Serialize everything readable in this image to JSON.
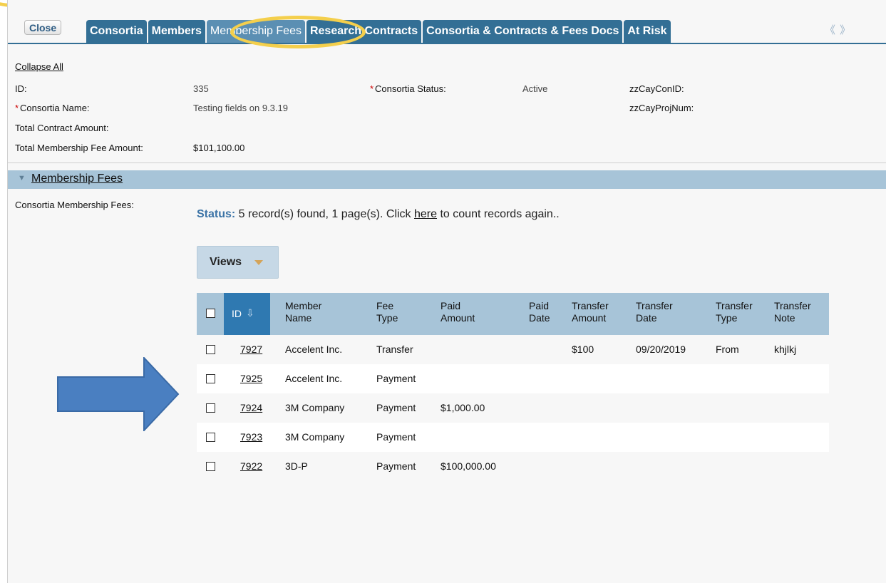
{
  "toolbar": {
    "close_label": "Close"
  },
  "tabs": [
    {
      "label": "Consortia"
    },
    {
      "label": "Members"
    },
    {
      "label": "Membership Fees"
    },
    {
      "label": "Research Contracts"
    },
    {
      "label": "Consortia & Contracts & Fees Docs"
    },
    {
      "label": "At Risk"
    }
  ],
  "tab_scroll": "《 》",
  "record": {
    "collapse_all": "Collapse All",
    "id_label": "ID:",
    "id_value": "335",
    "name_label": "Consortia Name:",
    "name_value": "Testing fields on 9.3.19",
    "total_contract_label": "Total Contract Amount:",
    "total_fee_label": "Total Membership Fee Amount:",
    "total_fee_value": "$101,100.00",
    "status_label": "Consortia Status:",
    "status_value": "Active",
    "cay_con_label": "zzCayConID:",
    "cay_proj_label": "zzCayProjNum:",
    "required_mark": "*"
  },
  "section": {
    "title": "Membership Fees",
    "chevron": "▼",
    "field_label": "Consortia Membership Fees:"
  },
  "status": {
    "prefix": "Status:",
    "text_a": " 5 record(s) found, 1 page(s). Click ",
    "link": "here",
    "text_b": " to count records again.."
  },
  "views": {
    "label": "Views"
  },
  "table": {
    "headers": {
      "id": "ID",
      "sort_icon": "⇩",
      "member_name": [
        "Member",
        "Name"
      ],
      "fee_type": [
        "Fee",
        "Type"
      ],
      "paid_amount": [
        "Paid",
        "Amount"
      ],
      "paid_date": [
        "Paid",
        "Date"
      ],
      "transfer_amount": [
        "Transfer",
        "Amount"
      ],
      "transfer_date": [
        "Transfer",
        "Date"
      ],
      "transfer_type": [
        "Transfer",
        "Type"
      ],
      "transfer_note": [
        "Transfer",
        "Note"
      ]
    },
    "rows": [
      {
        "id": "7927",
        "member": "Accelent Inc.",
        "fee_type": "Transfer",
        "paid_amount": "",
        "paid_date": "",
        "transfer_amount": "$100",
        "transfer_date": "09/20/2019",
        "transfer_type": "From",
        "transfer_note": "khjlkj"
      },
      {
        "id": "7925",
        "member": "Accelent Inc.",
        "fee_type": "Payment",
        "paid_amount": "",
        "paid_date": "",
        "transfer_amount": "",
        "transfer_date": "",
        "transfer_type": "",
        "transfer_note": ""
      },
      {
        "id": "7924",
        "member": "3M Company",
        "fee_type": "Payment",
        "paid_amount": "$1,000.00",
        "paid_date": "",
        "transfer_amount": "",
        "transfer_date": "",
        "transfer_type": "",
        "transfer_note": ""
      },
      {
        "id": "7923",
        "member": "3M Company",
        "fee_type": "Payment",
        "paid_amount": "",
        "paid_date": "",
        "transfer_amount": "",
        "transfer_date": "",
        "transfer_type": "",
        "transfer_note": ""
      },
      {
        "id": "7922",
        "member": "3D-P",
        "fee_type": "Payment",
        "paid_amount": "$100,000.00",
        "paid_date": "",
        "transfer_amount": "",
        "transfer_date": "",
        "transfer_type": "",
        "transfer_note": ""
      }
    ]
  },
  "colors": {
    "tab_bg": "#336f95",
    "tab_active_bg": "#5b8fb3",
    "header_bg": "#a7c4d8",
    "id_header_bg": "#2f79b1",
    "annotation_yellow": "#f4cf4c",
    "annotation_arrow": "#4a7fc1"
  }
}
